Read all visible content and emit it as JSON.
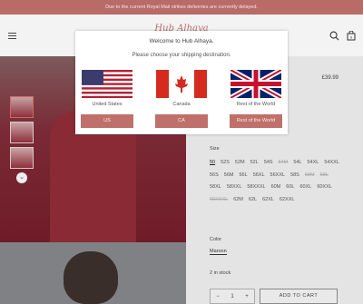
{
  "announcement": "Due to the current Royal Mail strikes deliveries are currently delayed.",
  "header": {
    "logo_text": "Hub Alhaya",
    "icons": [
      "menu-icon",
      "search-icon",
      "cart-icon"
    ],
    "cart_count": "0"
  },
  "product": {
    "price": "£39.99",
    "size_label": "Size",
    "sizes": [
      {
        "label": "50",
        "state": "selected"
      },
      {
        "label": "52S",
        "state": "available"
      },
      {
        "label": "52M",
        "state": "available"
      },
      {
        "label": "52L",
        "state": "available"
      },
      {
        "label": "54S",
        "state": "available"
      },
      {
        "label": "54M",
        "state": "unavailable"
      },
      {
        "label": "54L",
        "state": "available"
      },
      {
        "label": "54XL",
        "state": "available"
      },
      {
        "label": "54XXL",
        "state": "available"
      },
      {
        "label": "56S",
        "state": "available"
      },
      {
        "label": "56M",
        "state": "available"
      },
      {
        "label": "56L",
        "state": "available"
      },
      {
        "label": "56XL",
        "state": "available"
      },
      {
        "label": "56XXL",
        "state": "available"
      },
      {
        "label": "58S",
        "state": "available"
      },
      {
        "label": "58M",
        "state": "unavailable"
      },
      {
        "label": "58L",
        "state": "unavailable"
      },
      {
        "label": "58XL",
        "state": "available"
      },
      {
        "label": "58XXL",
        "state": "available"
      },
      {
        "label": "58XXXL",
        "state": "available"
      },
      {
        "label": "60M",
        "state": "available"
      },
      {
        "label": "60L",
        "state": "available"
      },
      {
        "label": "60XL",
        "state": "available"
      },
      {
        "label": "60XXL",
        "state": "available"
      },
      {
        "label": "60XXXL",
        "state": "unavailable"
      },
      {
        "label": "62M",
        "state": "available"
      },
      {
        "label": "62L",
        "state": "available"
      },
      {
        "label": "62XL",
        "state": "available"
      },
      {
        "label": "62XXL",
        "state": "available"
      }
    ],
    "color_label": "Color",
    "color_value": "Maroon",
    "stock": "2 in stock",
    "quantity": "1",
    "qty_minus": "−",
    "qty_plus": "+",
    "add_to_cart": "ADD TO CART"
  },
  "modal": {
    "title": "Welcome to Hub Alhaya.",
    "subtitle": "Please choose your shipping destination.",
    "options": [
      {
        "country": "United States",
        "button": "US",
        "flag": "us-flag-icon"
      },
      {
        "country": "Canada",
        "button": "CA",
        "flag": "canada-flag-icon"
      },
      {
        "country": "Rest of the World",
        "button": "Rest of the World",
        "flag": "uk-flag-icon"
      }
    ]
  },
  "colors": {
    "accent": "#b96b68",
    "button": "#c0706a"
  }
}
